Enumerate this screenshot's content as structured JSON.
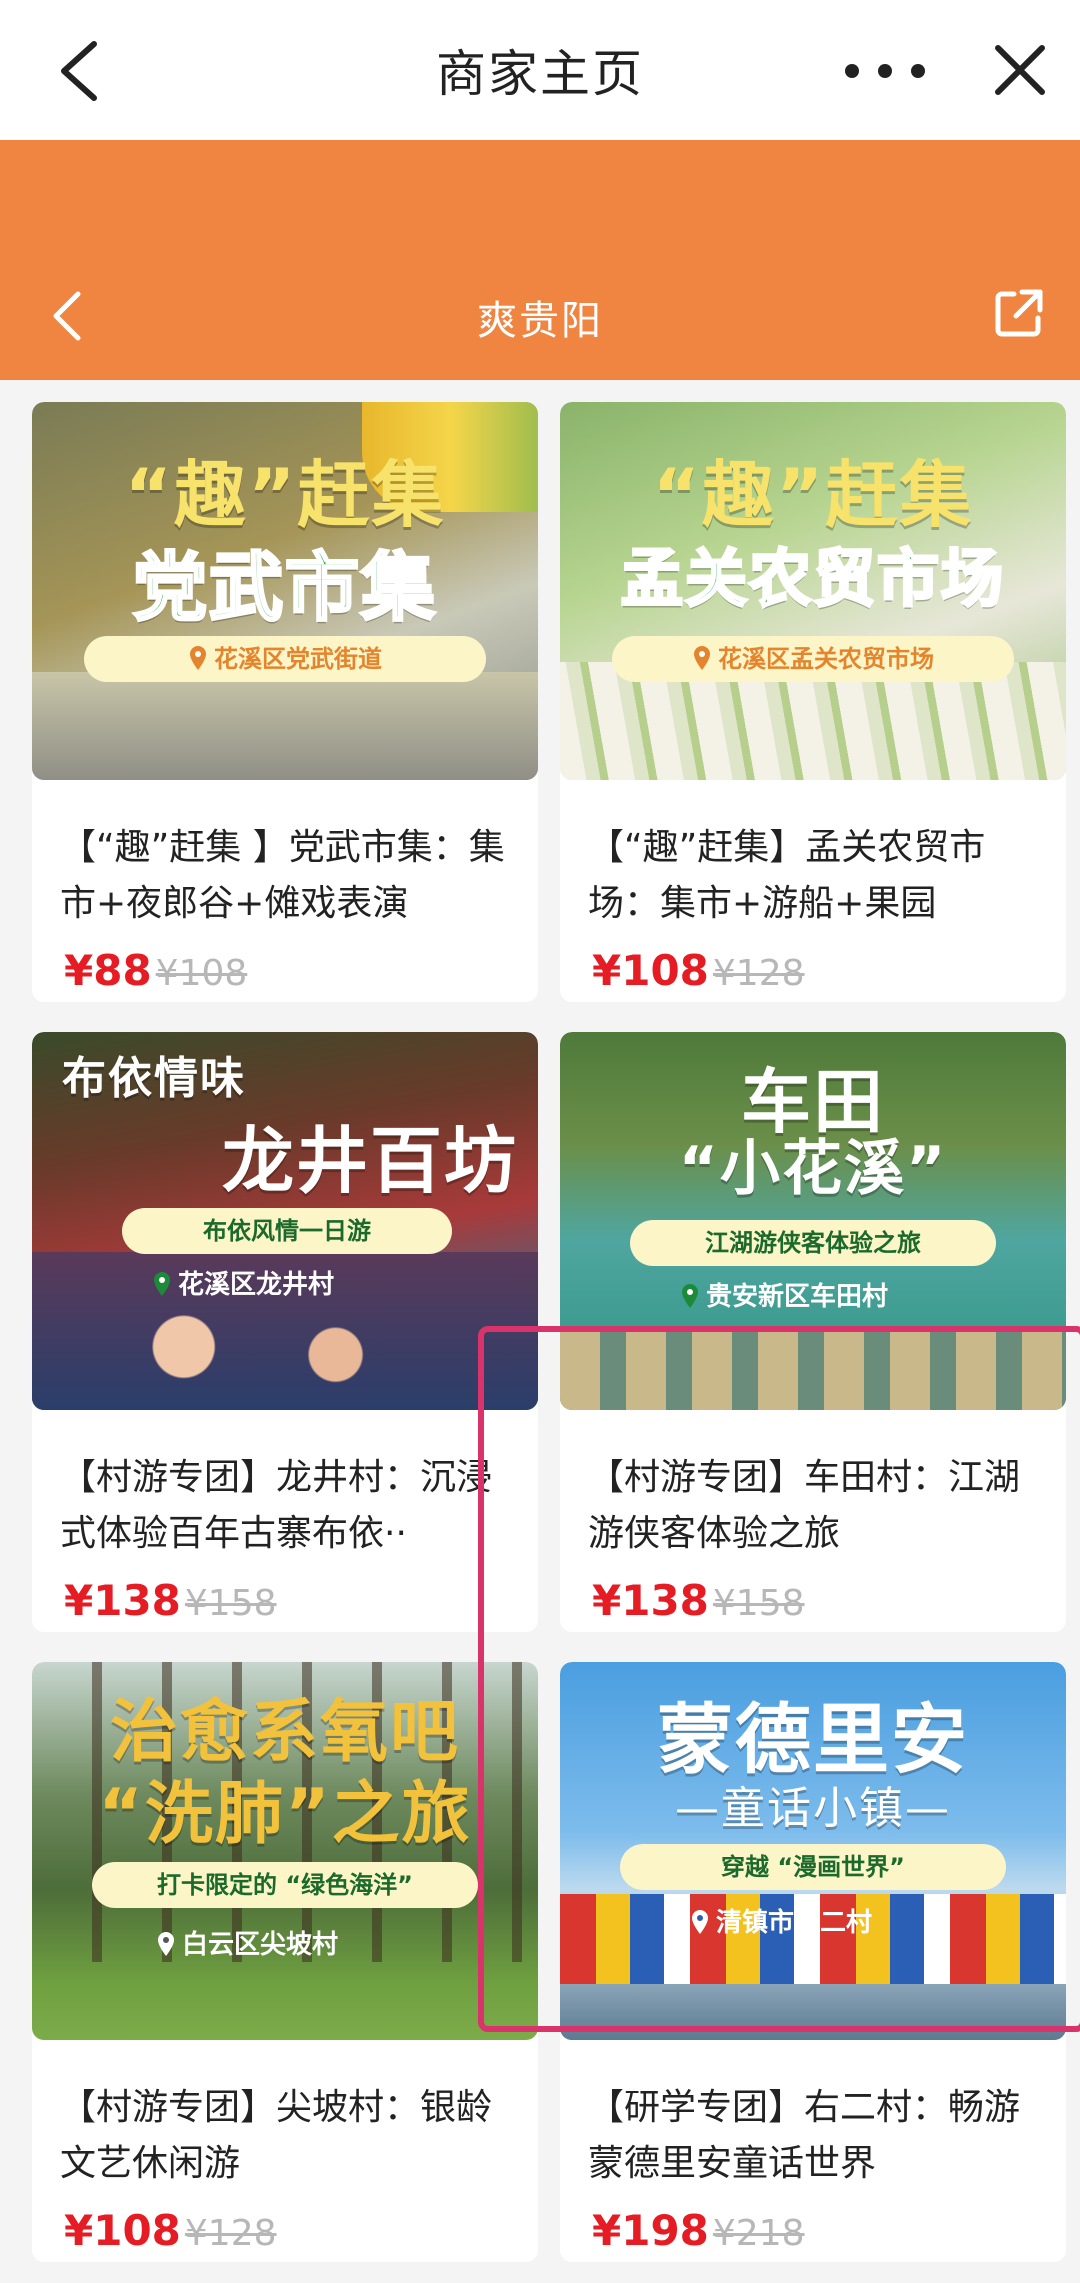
{
  "header": {
    "title": "商家主页",
    "sub_title": "爽贵阳"
  },
  "icons": {
    "back": "chevron-left-icon",
    "more": "more-dots-icon",
    "close": "close-icon",
    "share": "share-icon"
  },
  "cards": [
    {
      "poster": {
        "line1": "“趣”赶集",
        "line2": "党武市集",
        "pill": "花溪区党武街道"
      },
      "desc": "【“趣”赶集 】党武市集：集市+夜郎谷+傩戏表演",
      "price": "¥88",
      "old_price": "¥108"
    },
    {
      "poster": {
        "line1": "“趣”赶集",
        "line2": "孟关农贸市场",
        "pill": "花溪区孟关农贸市场"
      },
      "desc": "【“趣”赶集】孟关农贸市场：集市+游船+果园",
      "price": "¥108",
      "old_price": "¥128"
    },
    {
      "poster": {
        "line1": "布依情味",
        "line2": "龙井百坊",
        "pill": "布依风情一日游",
        "location": "花溪区龙井村"
      },
      "desc": "【村游专团】龙井村：沉浸式体验百年古寨布依··",
      "price": "¥138",
      "old_price": "¥158"
    },
    {
      "poster": {
        "line1": "车田",
        "line2": "“小花溪”",
        "pill": "江湖游侠客体验之旅",
        "location": "贵安新区车田村"
      },
      "desc": "【村游专团】车田村：江湖游侠客体验之旅",
      "price": "¥138",
      "old_price": "¥158"
    },
    {
      "poster": {
        "line1": "治愈系氧吧",
        "line2": "“洗肺”之旅",
        "pill": "打卡限定的 “绿色海洋”",
        "location": "白云区尖坡村"
      },
      "desc": "【村游专团】尖坡村：银龄文艺休闲游",
      "price": "¥108",
      "old_price": "¥128"
    },
    {
      "poster": {
        "line1": "蒙德里安",
        "line2": "—童话小镇—",
        "pill": "穿越 “漫画世界”",
        "location": "清镇市右二村"
      },
      "desc": "【研学专团】右二村：畅游蒙德里安童话世界",
      "price": "¥198",
      "old_price": "¥218"
    }
  ]
}
